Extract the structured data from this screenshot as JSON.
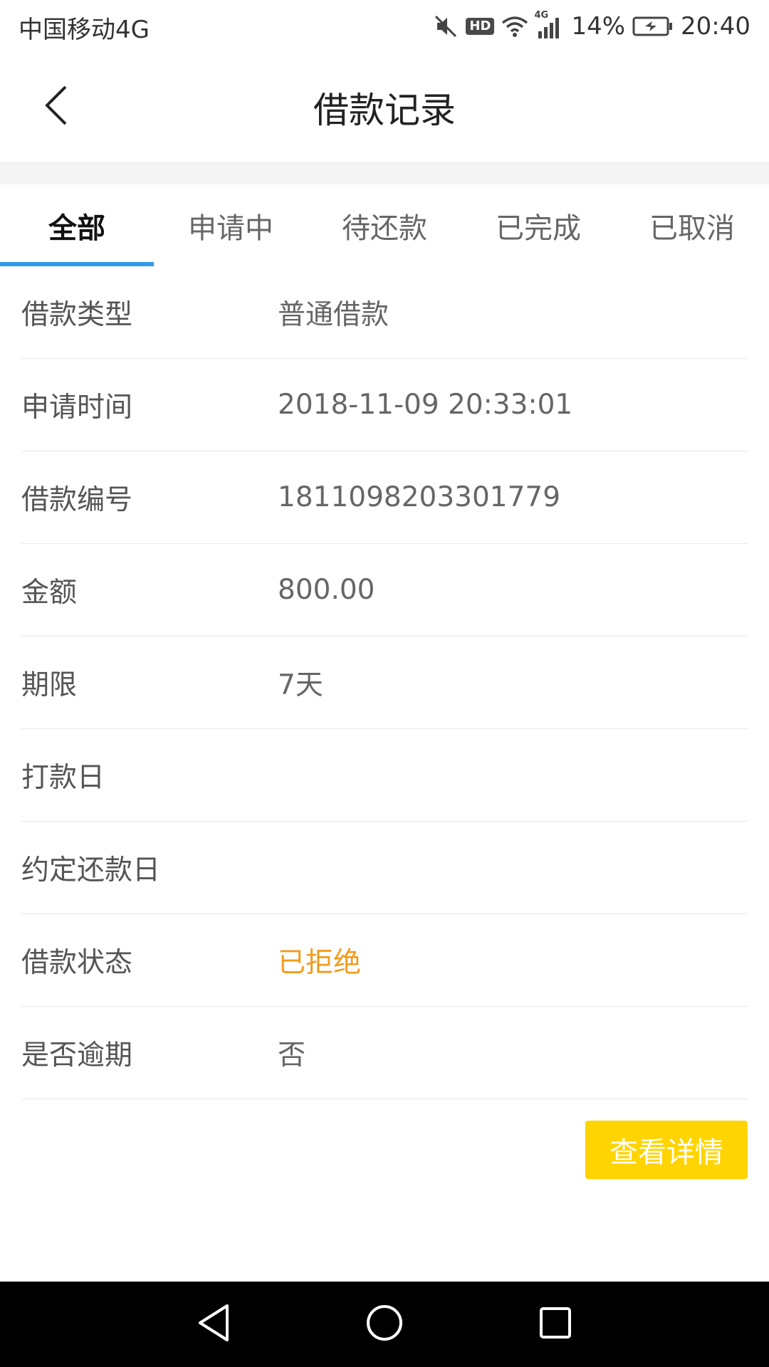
{
  "status_bar": {
    "carrier": "中国移动4G",
    "network_badge": "HD",
    "signal_label": "4G",
    "battery": "14%",
    "time": "20:40",
    "icons": [
      "mute-icon",
      "hd-icon",
      "wifi-icon",
      "signal-icon",
      "battery-charging-icon"
    ]
  },
  "header": {
    "title": "借款记录",
    "back_icon": "chevron-left-icon"
  },
  "tabs": [
    {
      "label": "全部",
      "active": true
    },
    {
      "label": "申请中",
      "active": false
    },
    {
      "label": "待还款",
      "active": false
    },
    {
      "label": "已完成",
      "active": false
    },
    {
      "label": "已取消",
      "active": false
    }
  ],
  "record": {
    "rows": [
      {
        "label": "借款类型",
        "value": "普通借款"
      },
      {
        "label": "申请时间",
        "value": "2018-11-09 20:33:01"
      },
      {
        "label": "借款编号",
        "value": "1811098203301779"
      },
      {
        "label": "金额",
        "value": "800.00"
      },
      {
        "label": "期限",
        "value": "7天"
      },
      {
        "label": "打款日",
        "value": ""
      },
      {
        "label": "约定还款日",
        "value": ""
      },
      {
        "label": "借款状态",
        "value": "已拒绝"
      },
      {
        "label": "是否逾期",
        "value": "否"
      }
    ],
    "detail_button": "查看详情"
  },
  "colors": {
    "accent_tab": "#2f9bea",
    "status_rejected": "#f29b1d",
    "button": "#ffd400"
  },
  "nav_bar": {
    "icons": [
      "back-triangle-icon",
      "home-circle-icon",
      "recents-square-icon"
    ]
  }
}
